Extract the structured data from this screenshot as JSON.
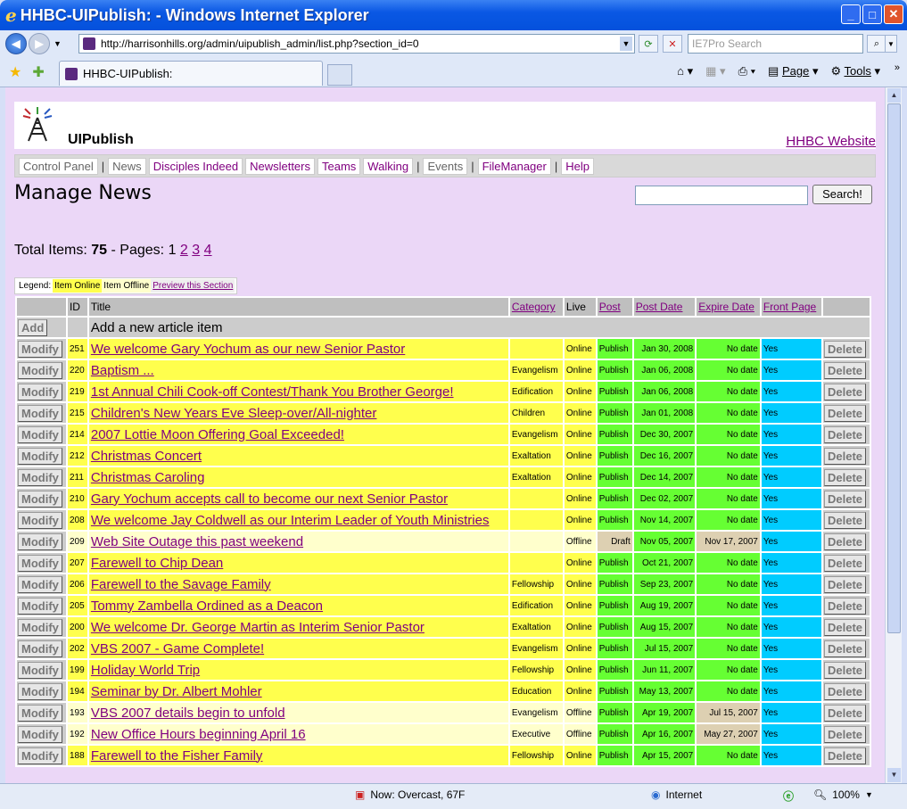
{
  "window": {
    "title": "HHBC-UIPublish: - Windows Internet Explorer"
  },
  "browser": {
    "url": "http://harrisonhills.org/admin/uipublish_admin/list.php?section_id=0",
    "search_placeholder": "IE7Pro Search",
    "tab_title": "HHBC-UIPublish:",
    "page_label": "Page",
    "tools_label": "Tools"
  },
  "site": {
    "brand": "UIPublish",
    "website_link": "HHBC Website"
  },
  "menu": [
    {
      "label": "Control Panel",
      "gray": true,
      "sep": true
    },
    {
      "label": "News",
      "gray": true,
      "sep": false
    },
    {
      "label": "Disciples Indeed",
      "sep": false
    },
    {
      "label": "Newsletters",
      "sep": false
    },
    {
      "label": "Teams",
      "sep": false
    },
    {
      "label": "Walking",
      "sep": true
    },
    {
      "label": "Events",
      "gray": true,
      "sep": true
    },
    {
      "label": "FileManager",
      "sep": true
    },
    {
      "label": "Help",
      "sep": false
    }
  ],
  "page": {
    "title": "Manage News",
    "search_button": "Search!"
  },
  "totals": {
    "prefix": "Total Items:",
    "count": "75",
    "pages_label": "- Pages:",
    "current_page": "1",
    "pages": [
      "2",
      "3",
      "4"
    ]
  },
  "legend": {
    "label": "Legend:",
    "online": "Item Online",
    "offline": "Item Offline",
    "preview": "Preview this Section"
  },
  "table": {
    "headers": {
      "id": "ID",
      "title": "Title",
      "category": "Category",
      "live": "Live",
      "post": "Post",
      "post_date": "Post Date",
      "expire_date": "Expire Date",
      "front_page": "Front Page"
    },
    "add_button": "Add",
    "add_text": "Add a new article item",
    "modify_label": "Modify",
    "delete_label": "Delete",
    "rows": [
      {
        "id": "251",
        "title": "We welcome Gary Yochum as our new Senior Pastor",
        "category": "",
        "live": "Online",
        "post": "Publish",
        "post_date": "Jan 30, 2008",
        "expire": "No date",
        "front": "Yes"
      },
      {
        "id": "220",
        "title": "Baptism ...",
        "category": "Evangelism",
        "live": "Online",
        "post": "Publish",
        "post_date": "Jan 06, 2008",
        "expire": "No date",
        "front": "Yes"
      },
      {
        "id": "219",
        "title": "1st Annual Chili Cook-off Contest/Thank You Brother George!",
        "category": "Edification",
        "live": "Online",
        "post": "Publish",
        "post_date": "Jan 06, 2008",
        "expire": "No date",
        "front": "Yes"
      },
      {
        "id": "215",
        "title": "Children's New Years Eve Sleep-over/All-nighter",
        "category": "Children",
        "live": "Online",
        "post": "Publish",
        "post_date": "Jan 01, 2008",
        "expire": "No date",
        "front": "Yes"
      },
      {
        "id": "214",
        "title": "2007 Lottie Moon Offering Goal Exceeded!",
        "category": "Evangelism",
        "live": "Online",
        "post": "Publish",
        "post_date": "Dec 30, 2007",
        "expire": "No date",
        "front": "Yes"
      },
      {
        "id": "212",
        "title": "Christmas Concert",
        "category": "Exaltation",
        "live": "Online",
        "post": "Publish",
        "post_date": "Dec 16, 2007",
        "expire": "No date",
        "front": "Yes"
      },
      {
        "id": "211",
        "title": "Christmas Caroling",
        "category": "Exaltation",
        "live": "Online",
        "post": "Publish",
        "post_date": "Dec 14, 2007",
        "expire": "No date",
        "front": "Yes"
      },
      {
        "id": "210",
        "title": "Gary Yochum accepts call to become our next Senior Pastor",
        "category": "",
        "live": "Online",
        "post": "Publish",
        "post_date": "Dec 02, 2007",
        "expire": "No date",
        "front": "Yes"
      },
      {
        "id": "208",
        "title": "We welcome Jay Coldwell as our Interim Leader of Youth Ministries",
        "category": "",
        "live": "Online",
        "post": "Publish",
        "post_date": "Nov 14, 2007",
        "expire": "No date",
        "front": "Yes"
      },
      {
        "id": "209",
        "title": "Web Site Outage this past weekend",
        "category": "",
        "live": "Offline",
        "post": "Draft",
        "post_date": "Nov 05, 2007",
        "expire": "Nov 17, 2007",
        "front": "Yes"
      },
      {
        "id": "207",
        "title": "Farewell to Chip Dean",
        "category": "",
        "live": "Online",
        "post": "Publish",
        "post_date": "Oct 21, 2007",
        "expire": "No date",
        "front": "Yes"
      },
      {
        "id": "206",
        "title": "Farewell to the Savage Family",
        "category": "Fellowship",
        "live": "Online",
        "post": "Publish",
        "post_date": "Sep 23, 2007",
        "expire": "No date",
        "front": "Yes"
      },
      {
        "id": "205",
        "title": "Tommy Zambella Ordined as a Deacon",
        "category": "Edification",
        "live": "Online",
        "post": "Publish",
        "post_date": "Aug 19, 2007",
        "expire": "No date",
        "front": "Yes"
      },
      {
        "id": "200",
        "title": "We welcome Dr. George Martin as Interim Senior Pastor",
        "category": "Exaltation",
        "live": "Online",
        "post": "Publish",
        "post_date": "Aug 15, 2007",
        "expire": "No date",
        "front": "Yes"
      },
      {
        "id": "202",
        "title": "VBS 2007 - Game Complete!",
        "category": "Evangelism",
        "live": "Online",
        "post": "Publish",
        "post_date": "Jul 15, 2007",
        "expire": "No date",
        "front": "Yes"
      },
      {
        "id": "199",
        "title": "Holiday World Trip",
        "category": "Fellowship",
        "live": "Online",
        "post": "Publish",
        "post_date": "Jun 11, 2007",
        "expire": "No date",
        "front": "Yes"
      },
      {
        "id": "194",
        "title": "Seminar by Dr. Albert Mohler",
        "category": "Education",
        "live": "Online",
        "post": "Publish",
        "post_date": "May 13, 2007",
        "expire": "No date",
        "front": "Yes"
      },
      {
        "id": "193",
        "title": "VBS 2007 details begin to unfold",
        "category": "Evangelism",
        "live": "Offline",
        "post": "Publish",
        "post_date": "Apr 19, 2007",
        "expire": "Jul 15, 2007",
        "front": "Yes"
      },
      {
        "id": "192",
        "title": "New Office Hours beginning April 16",
        "category": "Executive",
        "live": "Offline",
        "post": "Publish",
        "post_date": "Apr 16, 2007",
        "expire": "May 27, 2007",
        "front": "Yes"
      },
      {
        "id": "188",
        "title": "Farewell to the Fisher Family",
        "category": "Fellowship",
        "live": "Online",
        "post": "Publish",
        "post_date": "Apr 15, 2007",
        "expire": "No date",
        "front": "Yes"
      }
    ]
  },
  "statusbar": {
    "weather": "Now: Overcast, 67F",
    "zone": "Internet",
    "zoom": "100%"
  },
  "colors": {
    "online": "#ffff4d",
    "offline": "#ffffcc",
    "publish": "#66ff33",
    "front": "#00ccff",
    "page_bg": "#ebd7f7"
  }
}
